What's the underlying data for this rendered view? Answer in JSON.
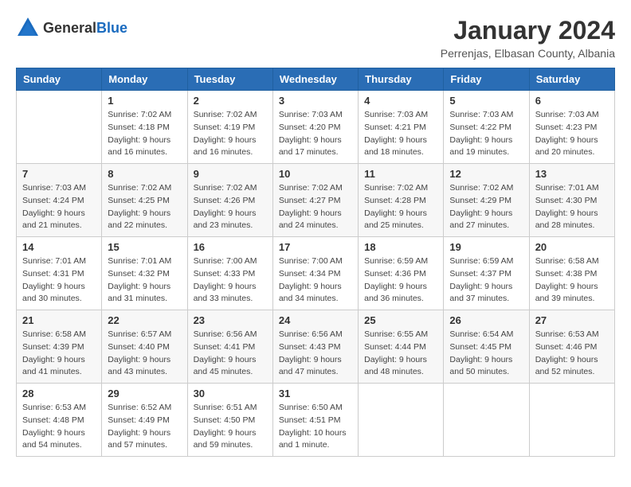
{
  "header": {
    "logo_general": "General",
    "logo_blue": "Blue",
    "month_year": "January 2024",
    "location": "Perrenjas, Elbasan County, Albania"
  },
  "days_of_week": [
    "Sunday",
    "Monday",
    "Tuesday",
    "Wednesday",
    "Thursday",
    "Friday",
    "Saturday"
  ],
  "weeks": [
    [
      {
        "day": "",
        "info": ""
      },
      {
        "day": "1",
        "info": "Sunrise: 7:02 AM\nSunset: 4:18 PM\nDaylight: 9 hours\nand 16 minutes."
      },
      {
        "day": "2",
        "info": "Sunrise: 7:02 AM\nSunset: 4:19 PM\nDaylight: 9 hours\nand 16 minutes."
      },
      {
        "day": "3",
        "info": "Sunrise: 7:03 AM\nSunset: 4:20 PM\nDaylight: 9 hours\nand 17 minutes."
      },
      {
        "day": "4",
        "info": "Sunrise: 7:03 AM\nSunset: 4:21 PM\nDaylight: 9 hours\nand 18 minutes."
      },
      {
        "day": "5",
        "info": "Sunrise: 7:03 AM\nSunset: 4:22 PM\nDaylight: 9 hours\nand 19 minutes."
      },
      {
        "day": "6",
        "info": "Sunrise: 7:03 AM\nSunset: 4:23 PM\nDaylight: 9 hours\nand 20 minutes."
      }
    ],
    [
      {
        "day": "7",
        "info": "Sunrise: 7:03 AM\nSunset: 4:24 PM\nDaylight: 9 hours\nand 21 minutes."
      },
      {
        "day": "8",
        "info": "Sunrise: 7:02 AM\nSunset: 4:25 PM\nDaylight: 9 hours\nand 22 minutes."
      },
      {
        "day": "9",
        "info": "Sunrise: 7:02 AM\nSunset: 4:26 PM\nDaylight: 9 hours\nand 23 minutes."
      },
      {
        "day": "10",
        "info": "Sunrise: 7:02 AM\nSunset: 4:27 PM\nDaylight: 9 hours\nand 24 minutes."
      },
      {
        "day": "11",
        "info": "Sunrise: 7:02 AM\nSunset: 4:28 PM\nDaylight: 9 hours\nand 25 minutes."
      },
      {
        "day": "12",
        "info": "Sunrise: 7:02 AM\nSunset: 4:29 PM\nDaylight: 9 hours\nand 27 minutes."
      },
      {
        "day": "13",
        "info": "Sunrise: 7:01 AM\nSunset: 4:30 PM\nDaylight: 9 hours\nand 28 minutes."
      }
    ],
    [
      {
        "day": "14",
        "info": "Sunrise: 7:01 AM\nSunset: 4:31 PM\nDaylight: 9 hours\nand 30 minutes."
      },
      {
        "day": "15",
        "info": "Sunrise: 7:01 AM\nSunset: 4:32 PM\nDaylight: 9 hours\nand 31 minutes."
      },
      {
        "day": "16",
        "info": "Sunrise: 7:00 AM\nSunset: 4:33 PM\nDaylight: 9 hours\nand 33 minutes."
      },
      {
        "day": "17",
        "info": "Sunrise: 7:00 AM\nSunset: 4:34 PM\nDaylight: 9 hours\nand 34 minutes."
      },
      {
        "day": "18",
        "info": "Sunrise: 6:59 AM\nSunset: 4:36 PM\nDaylight: 9 hours\nand 36 minutes."
      },
      {
        "day": "19",
        "info": "Sunrise: 6:59 AM\nSunset: 4:37 PM\nDaylight: 9 hours\nand 37 minutes."
      },
      {
        "day": "20",
        "info": "Sunrise: 6:58 AM\nSunset: 4:38 PM\nDaylight: 9 hours\nand 39 minutes."
      }
    ],
    [
      {
        "day": "21",
        "info": "Sunrise: 6:58 AM\nSunset: 4:39 PM\nDaylight: 9 hours\nand 41 minutes."
      },
      {
        "day": "22",
        "info": "Sunrise: 6:57 AM\nSunset: 4:40 PM\nDaylight: 9 hours\nand 43 minutes."
      },
      {
        "day": "23",
        "info": "Sunrise: 6:56 AM\nSunset: 4:41 PM\nDaylight: 9 hours\nand 45 minutes."
      },
      {
        "day": "24",
        "info": "Sunrise: 6:56 AM\nSunset: 4:43 PM\nDaylight: 9 hours\nand 47 minutes."
      },
      {
        "day": "25",
        "info": "Sunrise: 6:55 AM\nSunset: 4:44 PM\nDaylight: 9 hours\nand 48 minutes."
      },
      {
        "day": "26",
        "info": "Sunrise: 6:54 AM\nSunset: 4:45 PM\nDaylight: 9 hours\nand 50 minutes."
      },
      {
        "day": "27",
        "info": "Sunrise: 6:53 AM\nSunset: 4:46 PM\nDaylight: 9 hours\nand 52 minutes."
      }
    ],
    [
      {
        "day": "28",
        "info": "Sunrise: 6:53 AM\nSunset: 4:48 PM\nDaylight: 9 hours\nand 54 minutes."
      },
      {
        "day": "29",
        "info": "Sunrise: 6:52 AM\nSunset: 4:49 PM\nDaylight: 9 hours\nand 57 minutes."
      },
      {
        "day": "30",
        "info": "Sunrise: 6:51 AM\nSunset: 4:50 PM\nDaylight: 9 hours\nand 59 minutes."
      },
      {
        "day": "31",
        "info": "Sunrise: 6:50 AM\nSunset: 4:51 PM\nDaylight: 10 hours\nand 1 minute."
      },
      {
        "day": "",
        "info": ""
      },
      {
        "day": "",
        "info": ""
      },
      {
        "day": "",
        "info": ""
      }
    ]
  ]
}
